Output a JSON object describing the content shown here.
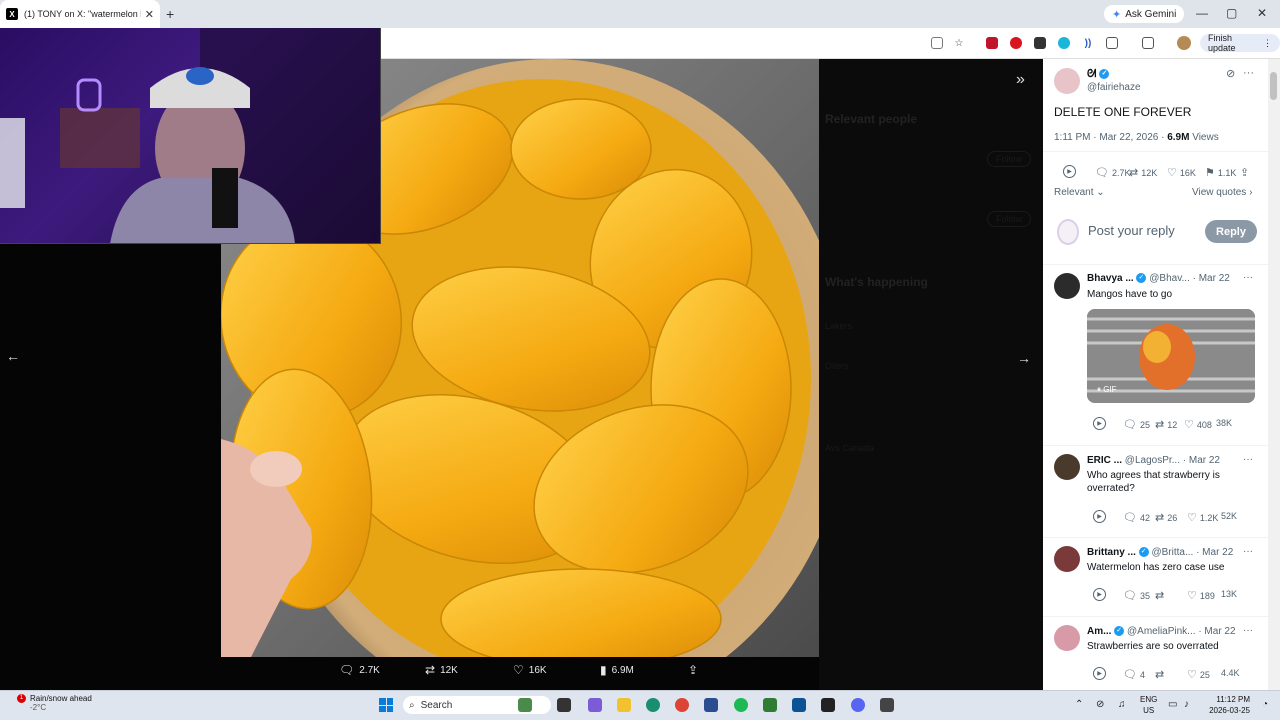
{
  "browser": {
    "tab_title": "(1) TONY on X: \"watermelon bc",
    "tab_close": "✕",
    "new_tab": "+",
    "ask_gemini": "Ask Gemini",
    "finish_update": "Finish update",
    "window": {
      "min": "—",
      "max": "▢",
      "close": "✕"
    }
  },
  "viewer": {
    "collapse_icon": "»",
    "next_icon": "→",
    "prev_icon": "←",
    "actions": {
      "replies": "2.7K",
      "reposts": "12K",
      "likes": "16K",
      "views": "6.9M"
    },
    "dim_panel": {
      "relevant_people": "Relevant people",
      "whats_happening": "What's happening",
      "follow": "Follow",
      "trend1": "Lakers",
      "trend2": "Oilers",
      "trend3": "Avs Canada"
    }
  },
  "post": {
    "author_name": "ᘛ",
    "author_handle": "@fairiehaze",
    "text": "DELETE ONE FOREVER",
    "time": "1:11 PM · Mar 22, 2026 · ",
    "views_count": "6.9M",
    "views_label": " Views",
    "stats": {
      "replies": "2.7K",
      "reposts": "12K",
      "likes": "16K",
      "bookmarks": "1.1K"
    },
    "sort": "Relevant",
    "view_quotes": "View quotes",
    "reply_placeholder": "Post your reply",
    "reply_button": "Reply"
  },
  "replies": [
    {
      "name": "Bhavya ...",
      "handle": "@Bhav...",
      "date": "· Mar 22",
      "text": "Mangos have to go",
      "gif": "GIF",
      "replies": "25",
      "reposts": "12",
      "likes": "408",
      "views": "38K"
    },
    {
      "name": "ERIC ...",
      "handle": "@LagosPr...",
      "date": "· Mar 22",
      "text": "Who agrees that strawberry is overrated?",
      "replies": "42",
      "reposts": "26",
      "likes": "1.2K",
      "views": "52K"
    },
    {
      "name": "Brittany ...",
      "handle": "@Britta...",
      "date": "· Mar 22",
      "text": "Watermelon has zero case use",
      "replies": "35",
      "reposts": "",
      "likes": "189",
      "views": "13K"
    },
    {
      "name": "Am...",
      "handle": "@AmeliaPink...",
      "date": "· Mar 22",
      "text": "Strawberries are so overrated",
      "replies": "4",
      "reposts": "",
      "likes": "25",
      "views": "4.4K"
    }
  ],
  "taskbar": {
    "weather": "Rain/snow ahead",
    "temp": "-2°C",
    "badge": "1",
    "search": "Search",
    "lang1": "ENG",
    "lang2": "US",
    "time": "11:12 PM",
    "date": "2026-03-25"
  },
  "colors": {
    "accent": "#1d9bf0",
    "mango": "#f5b015"
  }
}
